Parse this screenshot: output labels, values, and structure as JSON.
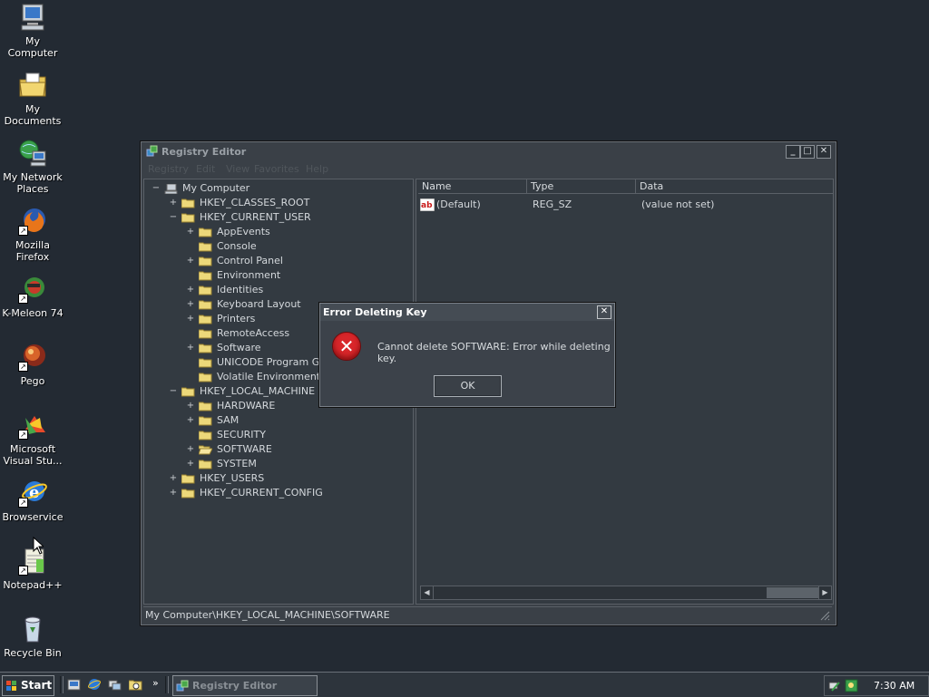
{
  "desktop": {
    "icons": [
      {
        "label": "My Computer"
      },
      {
        "label": "My Documents"
      },
      {
        "label": "My Network Places"
      },
      {
        "label": "Mozilla Firefox"
      },
      {
        "label": "K-Meleon 74"
      },
      {
        "label": "Pego"
      },
      {
        "label": "Microsoft Visual Stu..."
      },
      {
        "label": "Browservice"
      },
      {
        "label": "Notepad++"
      },
      {
        "label": "Recycle Bin"
      }
    ]
  },
  "registry_window": {
    "title": "Registry Editor",
    "menu": [
      "Registry",
      "Edit",
      "View",
      "Favorites",
      "Help"
    ],
    "tree": {
      "root": "My Computer",
      "hkcr": "HKEY_CLASSES_ROOT",
      "hkcu": "HKEY_CURRENT_USER",
      "hkcu_children": [
        "AppEvents",
        "Console",
        "Control Panel",
        "Environment",
        "Identities",
        "Keyboard Layout",
        "Printers",
        "RemoteAccess",
        "Software",
        "UNICODE Program Grou",
        "Volatile Environment"
      ],
      "hklm": "HKEY_LOCAL_MACHINE",
      "hklm_children": [
        "HARDWARE",
        "SAM",
        "SECURITY",
        "SOFTWARE",
        "SYSTEM"
      ],
      "hku": "HKEY_USERS",
      "hkcc": "HKEY_CURRENT_CONFIG"
    },
    "list": {
      "columns": [
        "Name",
        "Type",
        "Data"
      ],
      "rows": [
        {
          "name": "(Default)",
          "type": "REG_SZ",
          "data": "(value not set)"
        }
      ]
    },
    "status": "My Computer\\HKEY_LOCAL_MACHINE\\SOFTWARE"
  },
  "error_dialog": {
    "title": "Error Deleting Key",
    "message": "Cannot delete SOFTWARE:  Error while deleting key.",
    "ok_label": "OK"
  },
  "taskbar": {
    "start_label": "Start",
    "task_label": "Registry Editor",
    "clock": "7:30 AM"
  },
  "colors": {
    "desktop": "#232a33",
    "window": "#3a4047",
    "error_red": "#d8262a"
  }
}
